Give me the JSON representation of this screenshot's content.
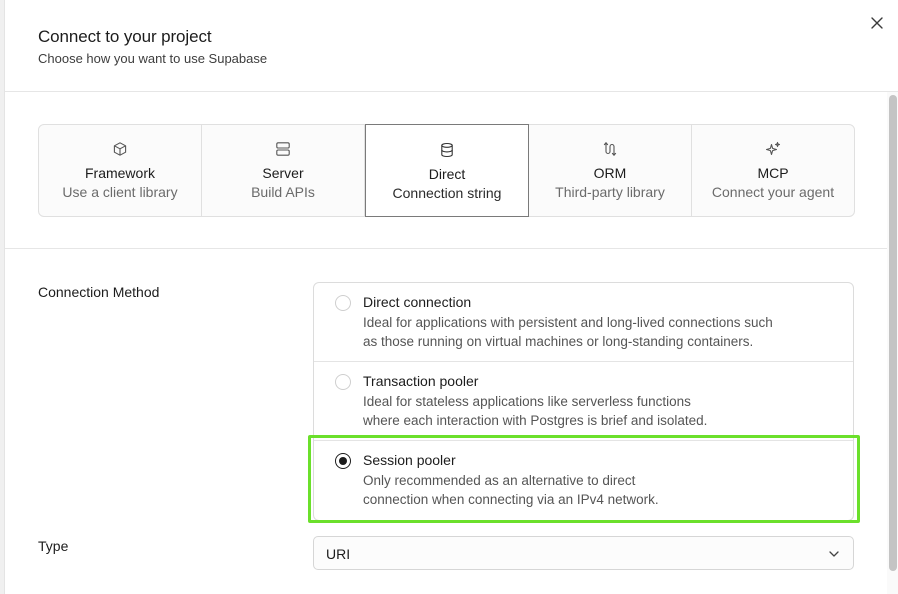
{
  "dialog": {
    "title": "Connect to your project",
    "subtitle": "Choose how you want to use Supabase",
    "close_icon": "x-icon"
  },
  "tabs": [
    {
      "label": "Framework",
      "desc": "Use a client library",
      "icon": "box-icon",
      "active": false
    },
    {
      "label": "Server",
      "desc": "Build APIs",
      "icon": "server-icon",
      "active": false
    },
    {
      "label": "Direct",
      "desc": "Connection string",
      "icon": "database-icon",
      "active": true
    },
    {
      "label": "ORM",
      "desc": "Third-party library",
      "icon": "orm-icon",
      "active": false
    },
    {
      "label": "MCP",
      "desc": "Connect your agent",
      "icon": "sparkles-icon",
      "active": false
    }
  ],
  "connection_method": {
    "label": "Connection Method",
    "options": [
      {
        "title": "Direct connection",
        "line1": "Ideal for applications with persistent and long-lived connections such",
        "line2": "as those running on virtual machines or long-standing containers.",
        "selected": false
      },
      {
        "title": "Transaction pooler",
        "line1": "Ideal for stateless applications like serverless functions",
        "line2": "where each interaction with Postgres is brief and isolated.",
        "selected": false
      },
      {
        "title": "Session pooler",
        "line1": "Only recommended as an alternative to direct",
        "line2": "connection when connecting via an IPv4 network.",
        "selected": true
      }
    ]
  },
  "type": {
    "label": "Type",
    "value": "URI"
  },
  "colors": {
    "highlight": "#6be02b",
    "text": "#1c1c1c",
    "muted": "#6b6b6b"
  }
}
